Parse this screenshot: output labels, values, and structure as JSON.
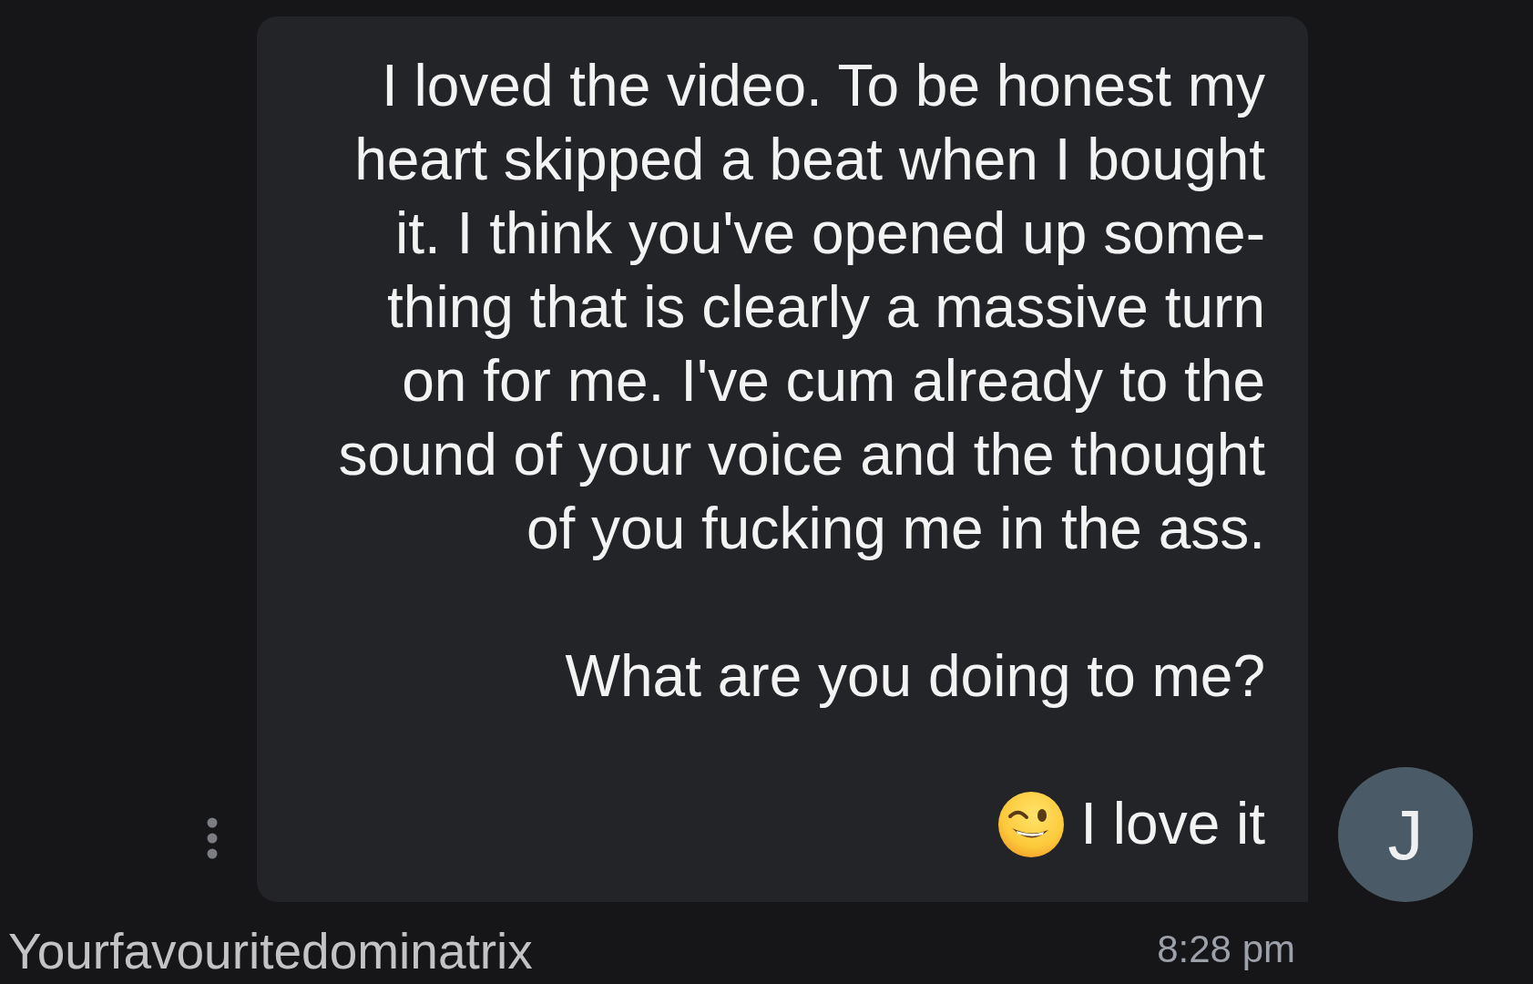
{
  "message": {
    "avatar": {
      "initial": "J"
    },
    "paragraphs": [
      {
        "kind": "plain",
        "text": "I loved the video. To be honest my\nheart skipped a beat when I bought\nit. I think you've opened up some-\nthing that is clearly a massive turn\non for me. I've cum already to the\nsound of your voice and the thought\nof you fucking me in the ass."
      },
      {
        "kind": "plain",
        "text": "What are you doing to me?"
      },
      {
        "kind": "with_emoji",
        "text": "I love it"
      }
    ],
    "time": "8:28 pm",
    "sender": "Yourfavouritedominatrix"
  }
}
